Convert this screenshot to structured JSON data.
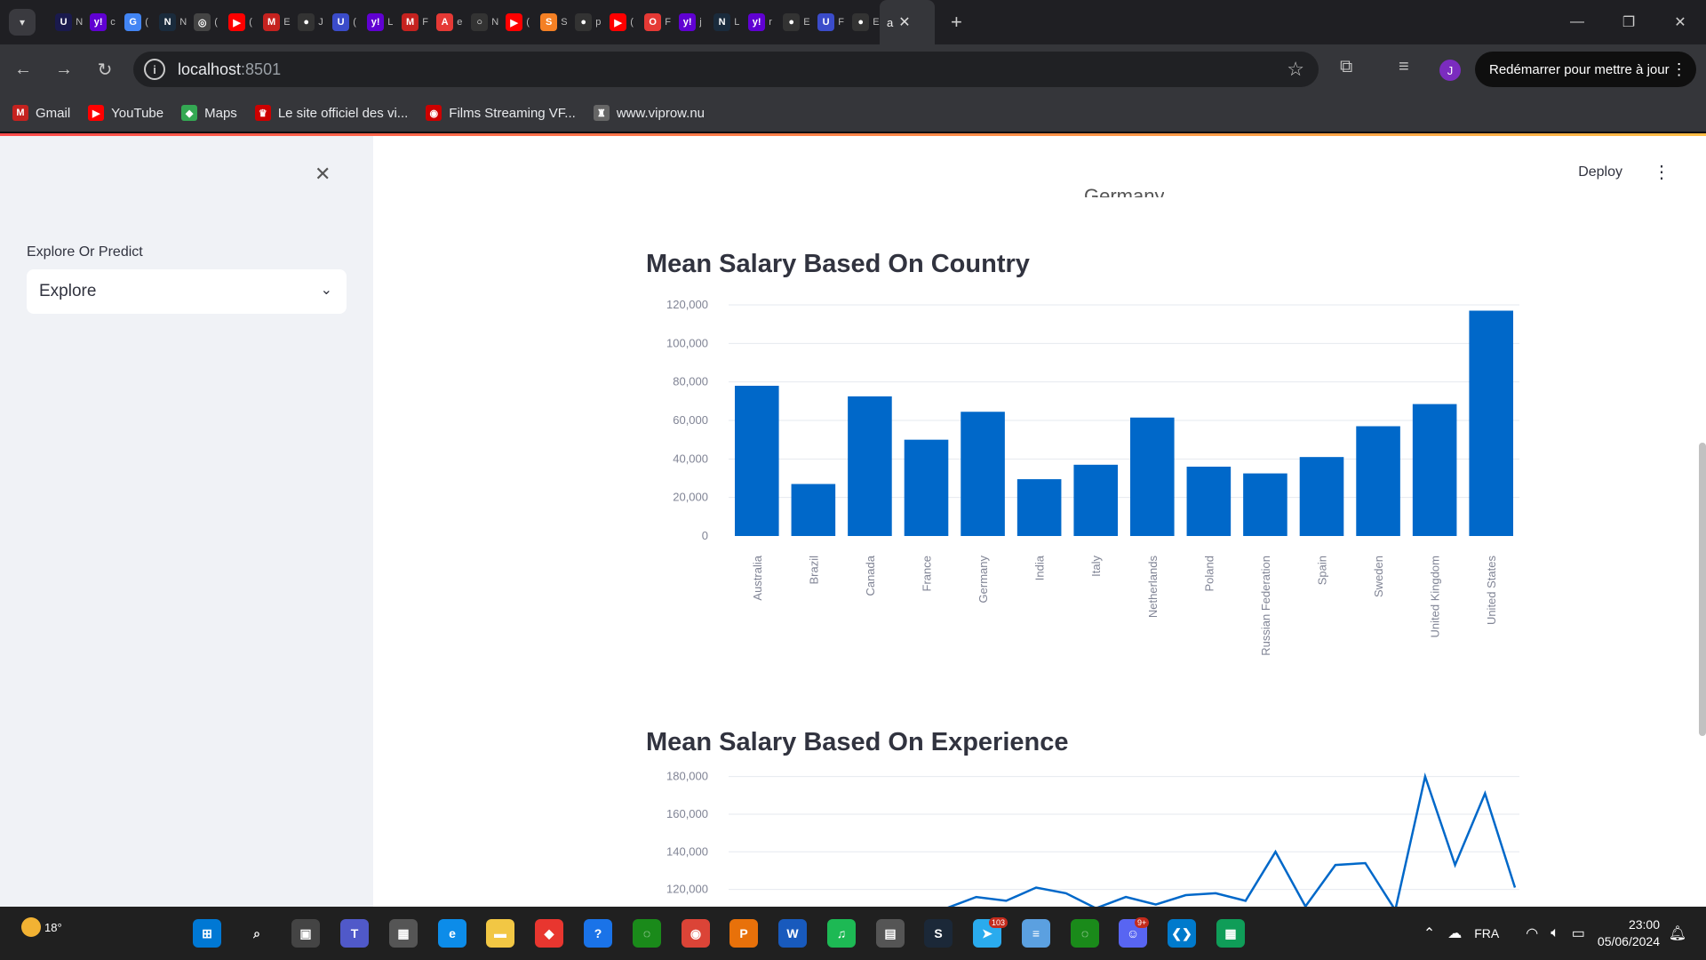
{
  "browser": {
    "tabs": [
      {
        "initial": "U",
        "color": "#1a1a4d",
        "title": "N"
      },
      {
        "initial": "y!",
        "color": "#6001d2",
        "title": "c"
      },
      {
        "initial": "G",
        "color": "#4285f4",
        "title": "("
      },
      {
        "initial": "N",
        "color": "#1a2b3c",
        "title": "N"
      },
      {
        "initial": "◎",
        "color": "#444",
        "title": "("
      },
      {
        "initial": "▶",
        "color": "#ff0000",
        "title": "("
      },
      {
        "initial": "M",
        "color": "#c5221f",
        "title": "E"
      },
      {
        "initial": "●",
        "color": "#333",
        "title": "J"
      },
      {
        "initial": "U",
        "color": "#3b4cca",
        "title": "("
      },
      {
        "initial": "y!",
        "color": "#6001d2",
        "title": "L"
      },
      {
        "initial": "M",
        "color": "#c5221f",
        "title": "F"
      },
      {
        "initial": "A",
        "color": "#e53935",
        "title": "e"
      },
      {
        "initial": "○",
        "color": "#333",
        "title": "N"
      },
      {
        "initial": "▶",
        "color": "#ff0000",
        "title": "("
      },
      {
        "initial": "S",
        "color": "#f48024",
        "title": "S"
      },
      {
        "initial": "●",
        "color": "#333",
        "title": "p"
      },
      {
        "initial": "▶",
        "color": "#ff0000",
        "title": "("
      },
      {
        "initial": "O",
        "color": "#e53935",
        "title": "F"
      },
      {
        "initial": "y!",
        "color": "#6001d2",
        "title": "j"
      },
      {
        "initial": "N",
        "color": "#1a2b3c",
        "title": "L"
      },
      {
        "initial": "y!",
        "color": "#6001d2",
        "title": "r"
      },
      {
        "initial": "●",
        "color": "#333",
        "title": "E"
      },
      {
        "initial": "U",
        "color": "#3b4cca",
        "title": "F"
      },
      {
        "initial": "●",
        "color": "#333",
        "title": "E"
      }
    ],
    "active_tab_title": "a",
    "url_host": "localhost",
    "url_port": ":8501",
    "restart_label": "Redémarrer pour mettre à jour",
    "profile_initial": "J",
    "bookmarks": [
      {
        "label": "Gmail",
        "icon": "M",
        "color": "#c5221f"
      },
      {
        "label": "YouTube",
        "icon": "▶",
        "color": "#ff0000"
      },
      {
        "label": "Maps",
        "icon": "◆",
        "color": "#34a853"
      },
      {
        "label": "Le site officiel des vi...",
        "icon": "♛",
        "color": "#c00"
      },
      {
        "label": "Films Streaming VF...",
        "icon": "◉",
        "color": "#c00"
      },
      {
        "label": "www.viprow.nu",
        "icon": "♜",
        "color": "#666"
      }
    ]
  },
  "sidebar": {
    "label": "Explore Or Predict",
    "selected": "Explore"
  },
  "header": {
    "deploy_label": "Deploy"
  },
  "cut_text": "Germany",
  "chart_data": [
    {
      "type": "bar",
      "title": "Mean Salary Based On Country",
      "categories": [
        "Australia",
        "Brazil",
        "Canada",
        "France",
        "Germany",
        "India",
        "Italy",
        "Netherlands",
        "Poland",
        "Russian Federation",
        "Spain",
        "Sweden",
        "United Kingdom",
        "United States"
      ],
      "values": [
        78000,
        27000,
        72500,
        50000,
        64500,
        29500,
        37000,
        61500,
        36000,
        32500,
        41000,
        57000,
        68500,
        117000
      ],
      "ylim": [
        0,
        120000
      ],
      "yticks": [
        "0",
        "20,000",
        "40,000",
        "60,000",
        "80,000",
        "100,000",
        "120,000"
      ],
      "color": "#0068c9",
      "grid": true
    },
    {
      "type": "line",
      "title": "Mean Salary Based On Experience",
      "ylim": [
        100000,
        185000
      ],
      "yticks": [
        "120,000",
        "140,000",
        "160,000",
        "180,000"
      ],
      "y": [
        110000,
        116000,
        114000,
        121000,
        118000,
        110000,
        116000,
        112000,
        117000,
        118000,
        114000,
        140000,
        111000,
        133000,
        134000,
        109000,
        180000,
        133000,
        171000,
        121000
      ],
      "color": "#0068c9"
    }
  ],
  "taskbar": {
    "temperature": "18°",
    "time": "23:00",
    "date": "05/06/2024",
    "lang": "FRA",
    "apps": [
      {
        "name": "windows-start",
        "glyph": "⊞",
        "color": "#0078d4"
      },
      {
        "name": "search",
        "glyph": "⌕",
        "color": "#202020"
      },
      {
        "name": "file-view",
        "glyph": "▣",
        "color": "#444"
      },
      {
        "name": "teams",
        "glyph": "T",
        "color": "#5059c9"
      },
      {
        "name": "store",
        "glyph": "▦",
        "color": "#555"
      },
      {
        "name": "edge",
        "glyph": "e",
        "color": "#0c8ce9"
      },
      {
        "name": "file-explorer",
        "glyph": "▬",
        "color": "#f2c744"
      },
      {
        "name": "gitkraken",
        "glyph": "◆",
        "color": "#e8362f"
      },
      {
        "name": "help",
        "glyph": "?",
        "color": "#1a73e8"
      },
      {
        "name": "progress",
        "glyph": "◌",
        "color": "#1a8a1a"
      },
      {
        "name": "chrome",
        "glyph": "◉",
        "color": "#db4437"
      },
      {
        "name": "pdf",
        "glyph": "P",
        "color": "#e8710a"
      },
      {
        "name": "docs",
        "glyph": "W",
        "color": "#185abd"
      },
      {
        "name": "spotify",
        "glyph": "♫",
        "color": "#1db954"
      },
      {
        "name": "calculator",
        "glyph": "▤",
        "color": "#555"
      },
      {
        "name": "steam",
        "glyph": "S",
        "color": "#1b2838"
      },
      {
        "name": "telegram",
        "glyph": "➤",
        "color": "#2aabee"
      },
      {
        "name": "notepad",
        "glyph": "≡",
        "color": "#5ba0e0"
      },
      {
        "name": "sync",
        "glyph": "◌",
        "color": "#1a8a1a"
      },
      {
        "name": "discord",
        "glyph": "☺",
        "color": "#5865f2"
      },
      {
        "name": "vscode",
        "glyph": "❮❯",
        "color": "#007acc"
      },
      {
        "name": "sheets",
        "glyph": "▦",
        "color": "#0f9d58"
      }
    ],
    "telegram_badge": "103",
    "discord_badge": "9+"
  }
}
